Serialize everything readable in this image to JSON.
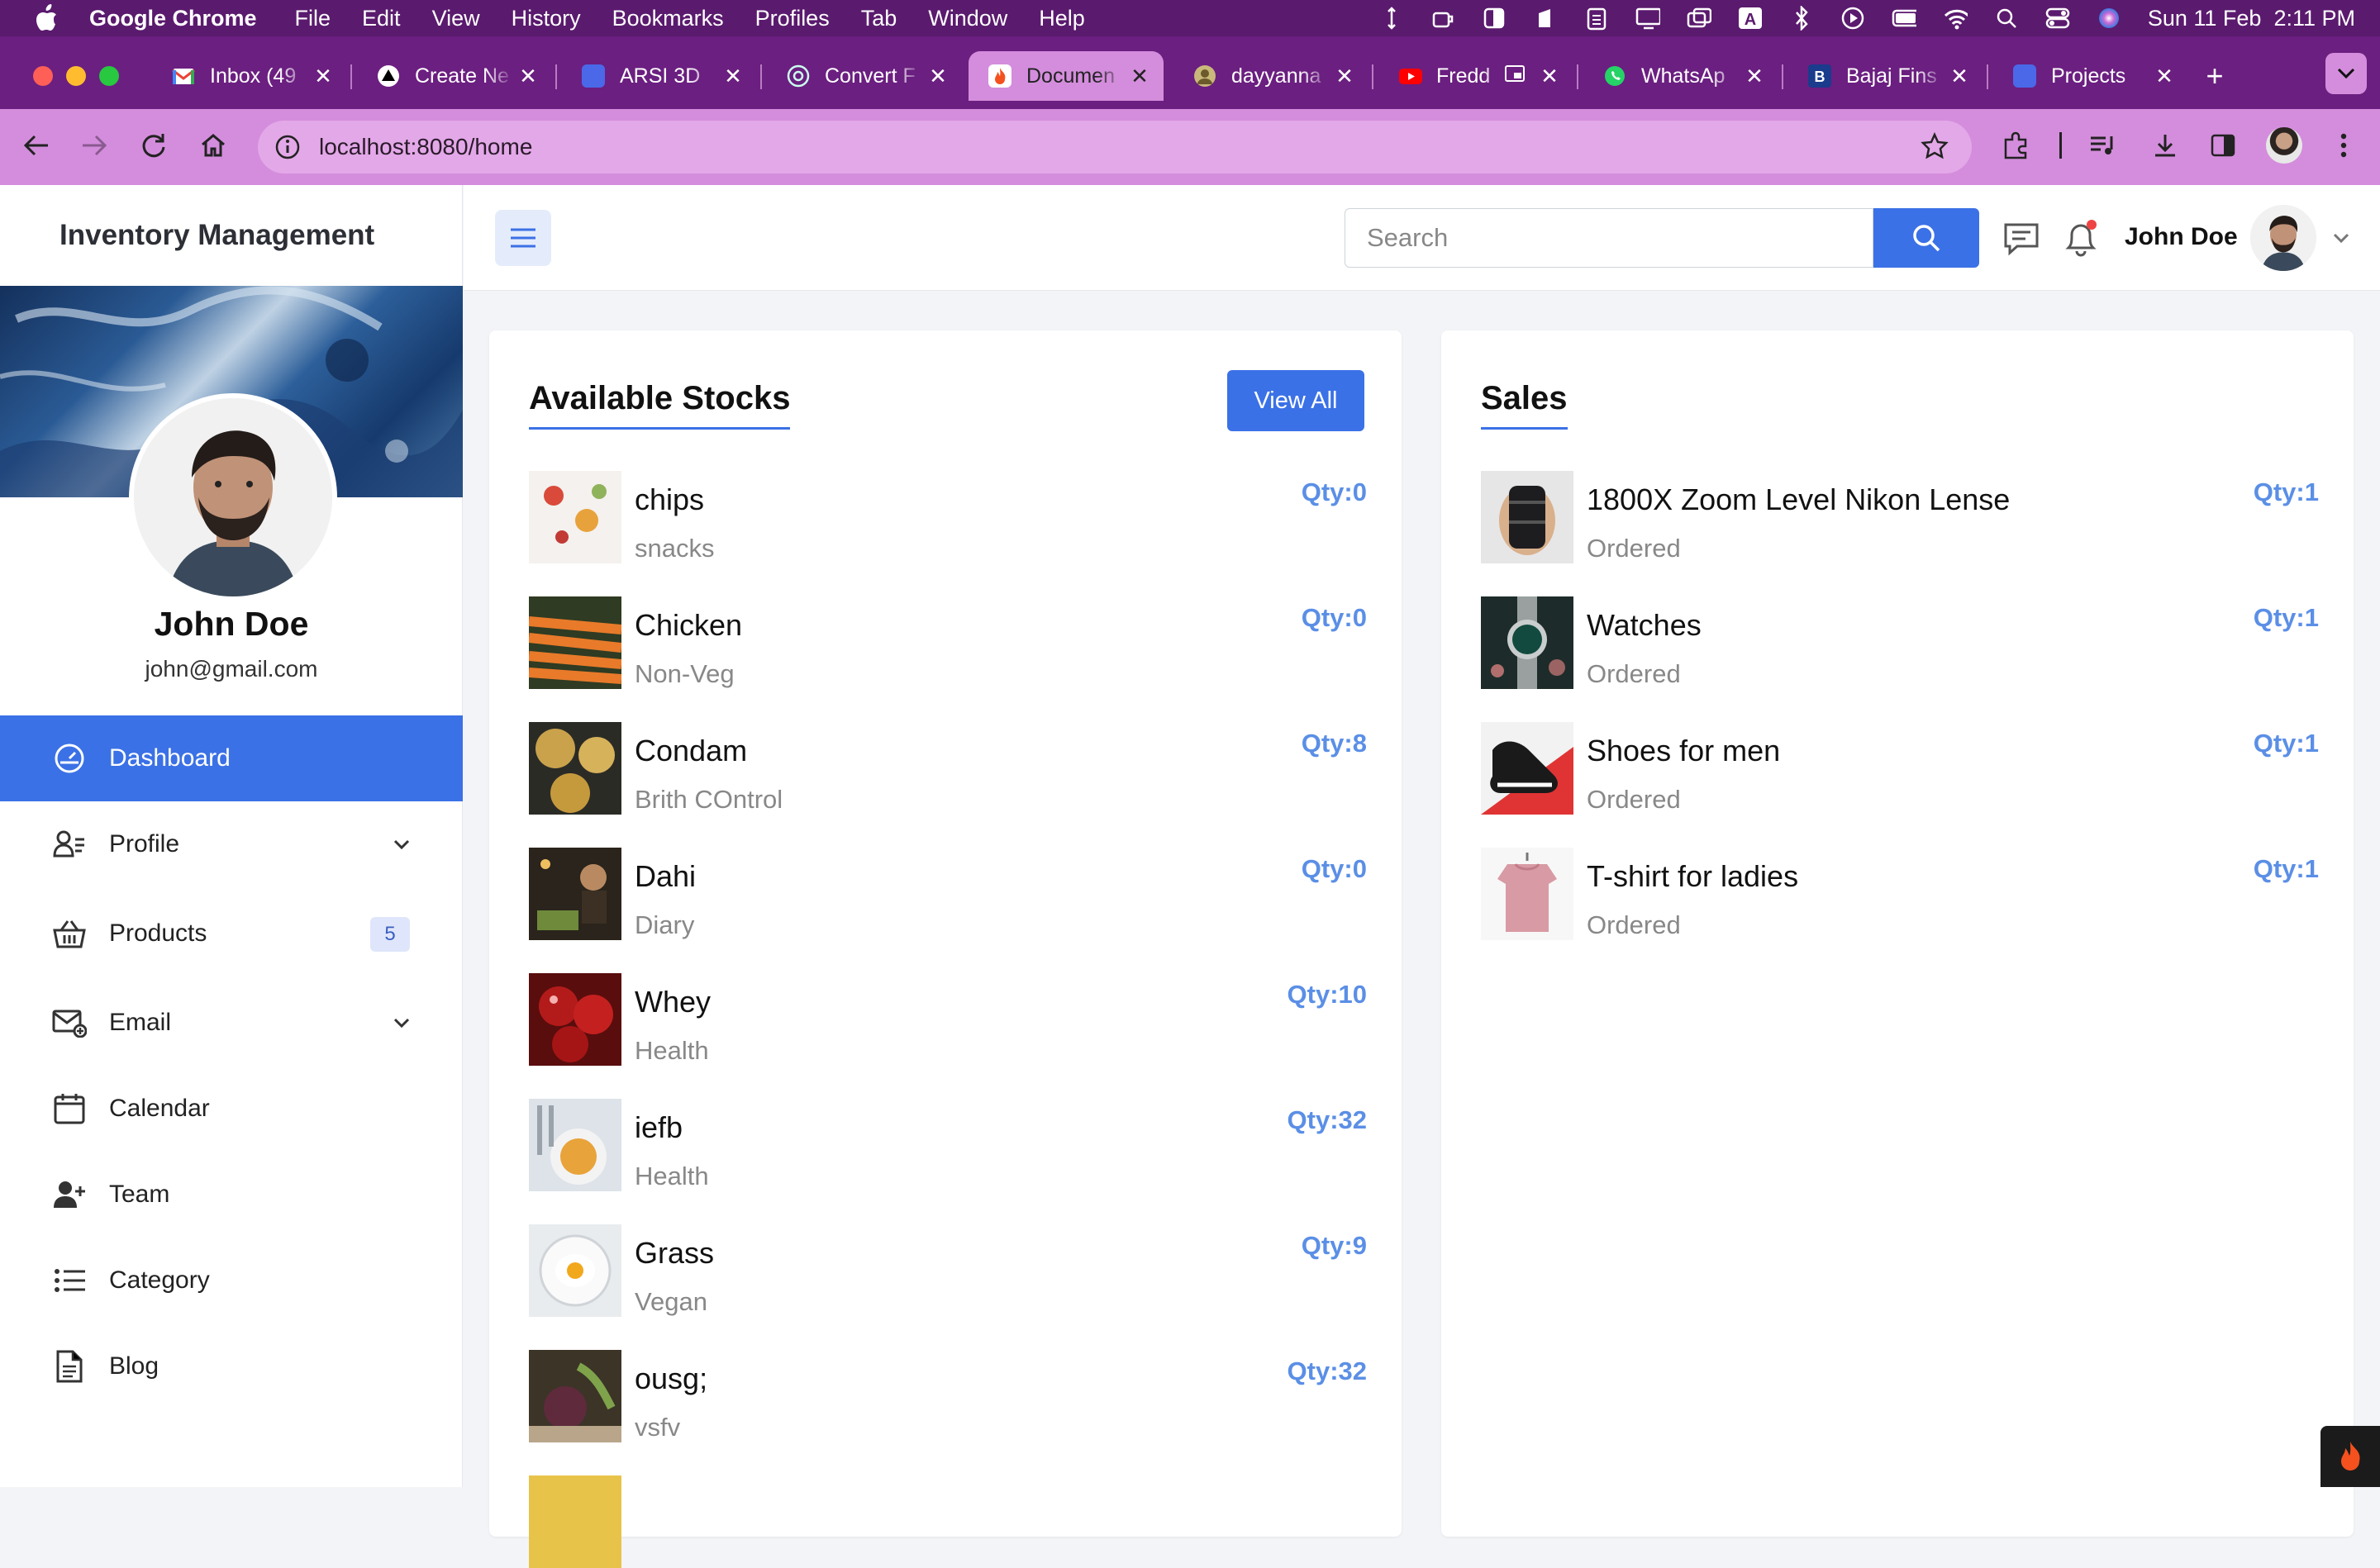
{
  "menubar": {
    "app_name": "Google Chrome",
    "items": [
      "File",
      "Edit",
      "View",
      "History",
      "Bookmarks",
      "Profiles",
      "Tab",
      "Window",
      "Help"
    ],
    "datetime": "Sun 11 Feb  2:11 PM"
  },
  "tabs": [
    {
      "title": "Inbox (49",
      "favicon": "gmail-icon",
      "color": "#ea4335"
    },
    {
      "title": "Create Ne",
      "favicon": "triangle-icon",
      "color": "#000000"
    },
    {
      "title": "ARSI 3D",
      "favicon": "doc-icon",
      "color": "#4a68e8"
    },
    {
      "title": "Convert F",
      "favicon": "openai-icon",
      "color": "#74aa9c"
    },
    {
      "title": "Documen",
      "favicon": "fire-icon",
      "color": "#f4511e",
      "active": true
    },
    {
      "title": "dayyanna",
      "favicon": "profile-icon",
      "color": "#9a8b4a"
    },
    {
      "title": "Fredd",
      "favicon": "youtube-icon",
      "color": "#ff0000"
    },
    {
      "title": "WhatsAp",
      "favicon": "whatsapp-icon",
      "color": "#25d366"
    },
    {
      "title": "Bajaj Fins",
      "favicon": "bajaj-icon",
      "color": "#1b3b8c"
    },
    {
      "title": "Projects",
      "favicon": "doc-icon",
      "color": "#4a68e8"
    }
  ],
  "address_bar": {
    "url": "localhost:8080/home"
  },
  "sidebar": {
    "brand": "Inventory Management",
    "user_name": "John Doe",
    "user_email": "john@gmail.com",
    "items": [
      {
        "label": "Dashboard",
        "icon": "dashboard-icon",
        "active": true
      },
      {
        "label": "Profile",
        "icon": "profile-icon",
        "has_chevron": true
      },
      {
        "label": "Products",
        "icon": "basket-icon",
        "badge": "5"
      },
      {
        "label": "Email",
        "icon": "email-icon",
        "has_chevron": true
      },
      {
        "label": "Calendar",
        "icon": "calendar-icon"
      },
      {
        "label": "Team",
        "icon": "team-icon"
      },
      {
        "label": "Category",
        "icon": "list-icon"
      },
      {
        "label": "Blog",
        "icon": "document-icon"
      }
    ]
  },
  "header": {
    "search_placeholder": "Search",
    "user_name": "John Doe"
  },
  "stocks": {
    "title": "Available Stocks",
    "view_all_label": "View All",
    "items": [
      {
        "name": "chips",
        "category": "snacks",
        "qty": "Qty:0"
      },
      {
        "name": "Chicken",
        "category": "Non-Veg",
        "qty": "Qty:0"
      },
      {
        "name": "Condam",
        "category": "Brith COntrol",
        "qty": "Qty:8"
      },
      {
        "name": "Dahi",
        "category": "Diary",
        "qty": "Qty:0"
      },
      {
        "name": "Whey",
        "category": "Health",
        "qty": "Qty:10"
      },
      {
        "name": "iefb",
        "category": "Health",
        "qty": "Qty:32"
      },
      {
        "name": "Grass",
        "category": "Vegan",
        "qty": "Qty:9"
      },
      {
        "name": "ousg;",
        "category": "vsfv",
        "qty": "Qty:32"
      }
    ]
  },
  "sales": {
    "title": "Sales",
    "items": [
      {
        "name": "1800X Zoom Level Nikon Lense",
        "status": "Ordered",
        "qty": "Qty:1"
      },
      {
        "name": "Watches",
        "status": "Ordered",
        "qty": "Qty:1"
      },
      {
        "name": "Shoes for men",
        "status": "Ordered",
        "qty": "Qty:1"
      },
      {
        "name": "T-shirt for ladies",
        "status": "Ordered",
        "qty": "Qty:1"
      }
    ]
  },
  "colors": {
    "accent": "#3b71e6",
    "qty": "#5b8fe6",
    "browser_frame": "#6b1f80",
    "toolbar": "#d48ddc"
  }
}
